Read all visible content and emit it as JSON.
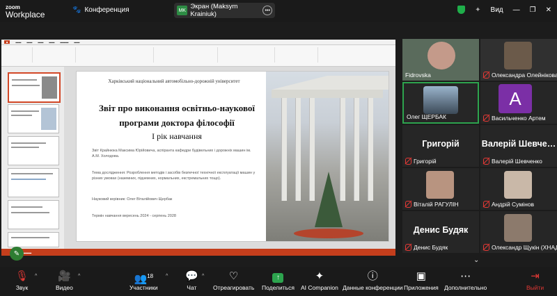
{
  "topbar": {
    "logo_line1": "zoom",
    "logo_line2": "Workplace",
    "meeting_label": "Конференция",
    "screen_initials": "MK",
    "screen_label": "Экран (Maksym Krainiuk)",
    "view_label": "Вид"
  },
  "slide": {
    "university": "Харківський національний автомобільно-дорожній університет",
    "title": "Звіт про виконання освітньо-наукової програми доктора філософії",
    "year": "І рік навчання",
    "author": "Звіт Крайнюка Максима Юрійовича, аспіранта кафедри будівельних і дорожніх машин ім. А.М. Холодова.",
    "topic": "Тема дослідження: Розроблення методів і засобів безпечної технічної експлуатації машин у різних умовах (наземних, підземних, нормальних, екстремальних тощо).",
    "supervisor": "Науковий керівник: Олег Віталійович Щербак",
    "term": "Термін навчання вересень 2024 - серпень 2028"
  },
  "participants": [
    {
      "name": "Fidrovska",
      "muted": false,
      "type": "video"
    },
    {
      "name": "Олександра Олейнікова",
      "muted": true,
      "type": "video"
    },
    {
      "name": "Олег ЩЕРБАК",
      "muted": false,
      "type": "video"
    },
    {
      "name": "Васильченко Артем",
      "muted": true,
      "type": "avatar",
      "initial": "A"
    },
    {
      "name": "Григорій",
      "muted": true,
      "type": "name",
      "big": "Григорій"
    },
    {
      "name": "Валерій Шевченко",
      "muted": true,
      "type": "name",
      "big": "Валерій Шевче…"
    },
    {
      "name": "Віталій РАГУЛІН",
      "muted": true,
      "type": "photo"
    },
    {
      "name": "Андрій Сумінов",
      "muted": true,
      "type": "photo"
    },
    {
      "name": "Денис Будяк",
      "muted": true,
      "type": "name",
      "big": "Денис Будяк"
    },
    {
      "name": "Олександр Щукін (ХНАД…",
      "muted": true,
      "type": "photo"
    }
  ],
  "toolbar": {
    "audio": "Звук",
    "video": "Видео",
    "participants": "Участники",
    "participants_count": "18",
    "chat": "Чат",
    "react": "Отреагировать",
    "share": "Поделиться",
    "ai": "AI Companion",
    "conf_data": "Данные конференции",
    "apps": "Приложения",
    "more": "Дополнительно",
    "leave": "Выйти"
  },
  "colors": {
    "accent_green": "#1fae4a",
    "share_green": "#2da44e",
    "danger_red": "#e53935",
    "ppt_red": "#c43e1c"
  }
}
